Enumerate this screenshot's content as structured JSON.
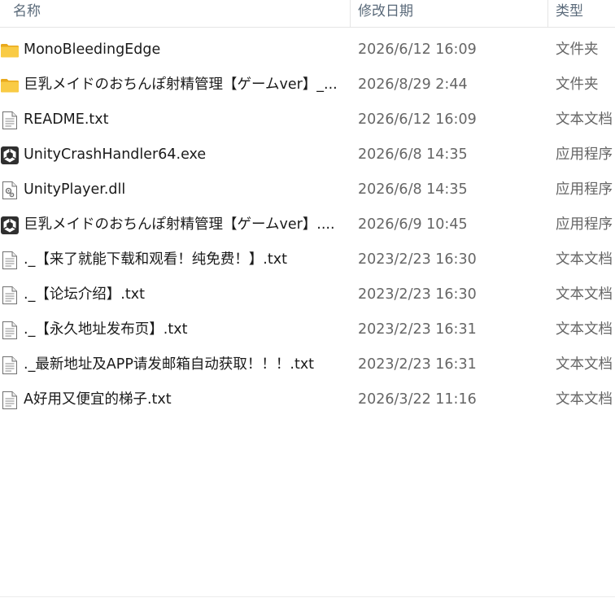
{
  "columns": {
    "name": "名称",
    "date": "修改日期",
    "type": "类型"
  },
  "files": [
    {
      "name": "MonoBleedingEdge",
      "date": "2026/6/12 16:09",
      "type": "文件夹",
      "icon": "folder-icon"
    },
    {
      "name": "巨乳メイドのおちんぽ射精管理【ゲームver】_...",
      "date": "2026/8/29 2:44",
      "type": "文件夹",
      "icon": "folder-icon"
    },
    {
      "name": "README.txt",
      "date": "2026/6/12 16:09",
      "type": "文本文档",
      "icon": "text-file-icon"
    },
    {
      "name": "UnityCrashHandler64.exe",
      "date": "2026/6/8 14:35",
      "type": "应用程序",
      "icon": "unity-app-icon"
    },
    {
      "name": "UnityPlayer.dll",
      "date": "2026/6/8 14:35",
      "type": "应用程序",
      "icon": "dll-file-icon"
    },
    {
      "name": "巨乳メイドのおちんぽ射精管理【ゲームver】....",
      "date": "2026/6/9 10:45",
      "type": "应用程序",
      "icon": "unity-app-icon"
    },
    {
      "name": "._【来了就能下载和观看！纯免费！】.txt",
      "date": "2023/2/23 16:30",
      "type": "文本文档",
      "icon": "text-file-icon"
    },
    {
      "name": "._【论坛介绍】.txt",
      "date": "2023/2/23 16:30",
      "type": "文本文档",
      "icon": "text-file-icon"
    },
    {
      "name": "._【永久地址发布页】.txt",
      "date": "2023/2/23 16:31",
      "type": "文本文档",
      "icon": "text-file-icon"
    },
    {
      "name": "._最新地址及APP请发邮箱自动获取！！！.txt",
      "date": "2023/2/23 16:31",
      "type": "文本文档",
      "icon": "text-file-icon"
    },
    {
      "name": "A好用又便宜的梯子.txt",
      "date": "2026/3/22 11:16",
      "type": "文本文档",
      "icon": "text-file-icon"
    }
  ],
  "colors": {
    "folder": "#f8c93b",
    "header_text": "#5a6a7a",
    "name_text": "#1a1a1a",
    "meta_text": "#666666"
  }
}
